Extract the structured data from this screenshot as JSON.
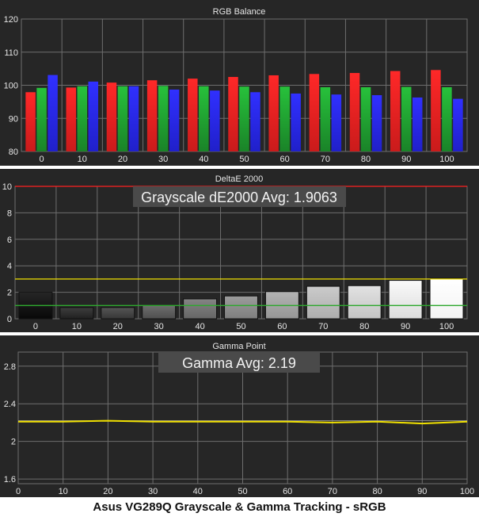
{
  "footer": {
    "caption": "Asus VG289Q Grayscale & Gamma Tracking - sRGB"
  },
  "colors": {
    "red": "#ee2020",
    "green": "#1f9a2f",
    "blue": "#2626ee",
    "yellow": "#f0e000",
    "limit_red": "#ff2020",
    "tolerance_green": "#2ea82e",
    "background": "#262626",
    "grid": "#6e6e6e"
  },
  "chart_data": [
    {
      "type": "bar",
      "title": "RGB Balance",
      "categories": [
        "0",
        "10",
        "20",
        "30",
        "40",
        "50",
        "60",
        "70",
        "80",
        "90",
        "100"
      ],
      "ylim": [
        80,
        120
      ],
      "yticks": [
        80,
        90,
        100,
        110,
        120
      ],
      "grid": true,
      "series": [
        {
          "name": "",
          "color": "#ee2020",
          "values": [
            97.9,
            99.3,
            100.8,
            101.5,
            102,
            102.5,
            103,
            103.4,
            103.7,
            104.3,
            104.6
          ]
        },
        {
          "name": "",
          "color": "#1f9a2f",
          "values": [
            99.2,
            99.7,
            99.7,
            99.8,
            99.7,
            99.6,
            99.6,
            99.4,
            99.4,
            99.5,
            99.4
          ]
        },
        {
          "name": "",
          "color": "#2626ee",
          "values": [
            103.1,
            101.1,
            99.7,
            98.7,
            98.4,
            97.9,
            97.5,
            97.2,
            97,
            96.3,
            95.9
          ]
        }
      ]
    },
    {
      "type": "bar",
      "title": "DeltaE 2000",
      "annotation": "Grayscale dE2000 Avg: 1.9063",
      "categories": [
        "0",
        "10",
        "20",
        "30",
        "40",
        "50",
        "60",
        "70",
        "80",
        "90",
        "100"
      ],
      "values": [
        2.0,
        0.85,
        0.85,
        1.0,
        1.5,
        1.72,
        2.05,
        2.45,
        2.5,
        2.9,
        3.05
      ],
      "ylim": [
        0,
        10
      ],
      "yticks": [
        0,
        2,
        4,
        6,
        8,
        10
      ],
      "grid": true,
      "reference_lines": [
        {
          "value": 10,
          "color": "#ff2020"
        },
        {
          "value": 3,
          "color": "#f0e000"
        },
        {
          "value": 1,
          "color": "#2ea82e"
        }
      ]
    },
    {
      "type": "line",
      "title": "Gamma Point",
      "annotation": "Gamma Avg: 2.19",
      "x": [
        0,
        10,
        20,
        30,
        40,
        50,
        60,
        70,
        80,
        90,
        100
      ],
      "xticks": [
        0,
        10,
        20,
        30,
        40,
        50,
        60,
        70,
        80,
        90,
        100
      ],
      "ylim": [
        1.55,
        2.95
      ],
      "yticks": [
        1.6,
        2,
        2.4,
        2.8
      ],
      "ytick_labels": [
        "1.6",
        "2",
        "2.4",
        "2.8"
      ],
      "grid": true,
      "series": [
        {
          "name": "",
          "color": "#f0e000",
          "values": [
            2.21,
            2.21,
            2.22,
            2.21,
            2.21,
            2.21,
            2.21,
            2.2,
            2.21,
            2.19,
            2.21
          ]
        }
      ],
      "reference_lines": [
        {
          "value": 2.22,
          "color": "#8a8a8a"
        }
      ]
    }
  ]
}
